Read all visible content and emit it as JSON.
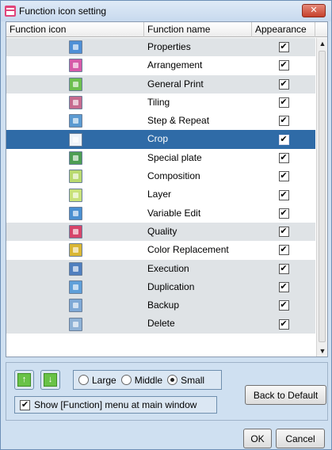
{
  "window": {
    "title": "Function icon setting",
    "close_label": "✕"
  },
  "table": {
    "headers": [
      "Function icon",
      "Function name",
      "Appearance"
    ],
    "rows": [
      {
        "name": "Properties",
        "icon": "properties-icon",
        "icon_color": "#4e8fd6",
        "checked": true,
        "shaded": true
      },
      {
        "name": "Arrangement",
        "icon": "arrangement-icon",
        "icon_color": "#d65aa8",
        "checked": true,
        "shaded": false
      },
      {
        "name": "General Print",
        "icon": "general-print-icon",
        "icon_color": "#6dbf4f",
        "checked": true,
        "shaded": true
      },
      {
        "name": "Tiling",
        "icon": "tiling-icon",
        "icon_color": "#c66b8f",
        "checked": true,
        "shaded": false
      },
      {
        "name": "Step & Repeat",
        "icon": "step-repeat-icon",
        "icon_color": "#5b9ad1",
        "checked": true,
        "shaded": false
      },
      {
        "name": "Crop",
        "icon": "crop-icon",
        "icon_color": "#eef3f9",
        "checked": true,
        "shaded": false,
        "selected": true
      },
      {
        "name": "Special plate",
        "icon": "special-plate-icon",
        "icon_color": "#4d9d53",
        "checked": true,
        "shaded": false
      },
      {
        "name": "Composition",
        "icon": "composition-icon",
        "icon_color": "#b9d96f",
        "checked": true,
        "shaded": false
      },
      {
        "name": "Layer",
        "icon": "layer-icon",
        "icon_color": "#c9e27a",
        "checked": true,
        "shaded": false
      },
      {
        "name": "Variable Edit",
        "icon": "variable-edit-icon",
        "icon_color": "#4a8fd0",
        "checked": true,
        "shaded": false
      },
      {
        "name": "Quality",
        "icon": "quality-icon",
        "icon_color": "#d6456a",
        "checked": true,
        "shaded": true
      },
      {
        "name": "Color Replacement",
        "icon": "color-replacement-icon",
        "icon_color": "#d9b635",
        "checked": true,
        "shaded": false
      },
      {
        "name": "Execution",
        "icon": "execution-icon",
        "icon_color": "#4f7fbf",
        "checked": true,
        "shaded": true
      },
      {
        "name": "Duplication",
        "icon": "duplication-icon",
        "icon_color": "#5f9fd9",
        "checked": true,
        "shaded": true
      },
      {
        "name": "Backup",
        "icon": "backup-icon",
        "icon_color": "#7fa9d6",
        "checked": true,
        "shaded": true
      },
      {
        "name": "Delete",
        "icon": "delete-icon",
        "icon_color": "#8fb2d6",
        "checked": true,
        "shaded": true
      }
    ]
  },
  "controls": {
    "move_up_label": "↑",
    "move_down_label": "↓",
    "size_options": [
      {
        "label": "Large",
        "selected": false
      },
      {
        "label": "Middle",
        "selected": false
      },
      {
        "label": "Small",
        "selected": true
      }
    ],
    "show_menu_label": "Show [Function] menu at main window",
    "show_menu_checked": true,
    "back_to_default_label": "Back to Default",
    "ok_label": "OK",
    "cancel_label": "Cancel"
  },
  "colors": {
    "selected_row": "#2f6ba7",
    "shaded_row": "#dfe3e6",
    "window_background": "#cfe0f1"
  }
}
